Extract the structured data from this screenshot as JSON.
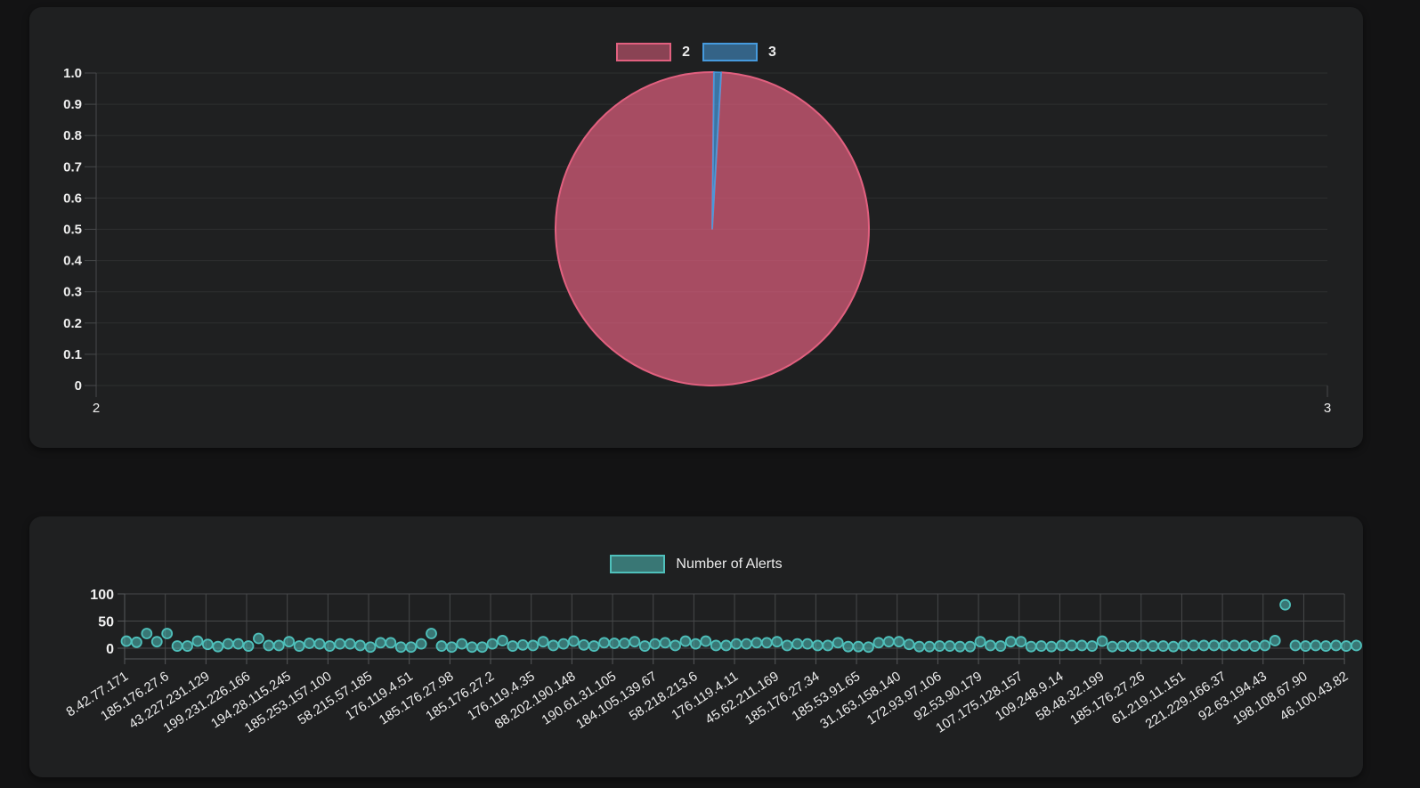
{
  "page": {
    "background": "#131314",
    "panel_background": "#1f2021"
  },
  "pie_panel": {
    "legend_labels": [
      "2",
      "3"
    ]
  },
  "scatter_panel": {
    "legend_labels": [
      "Number of Alerts"
    ]
  },
  "chart_data": [
    {
      "type": "pie",
      "title": "",
      "legend": [
        "2",
        "3"
      ],
      "legend_position": "top-center",
      "slices": [
        {
          "name": "2",
          "fraction": 0.9925,
          "color": "#e1607f"
        },
        {
          "name": "3",
          "fraction": 0.0075,
          "color": "#469add"
        }
      ],
      "slice_start_offset_deg": 0.6,
      "y_axis": {
        "tick_labels": [
          "1.0",
          "0.9",
          "0.8",
          "0.7",
          "0.6",
          "0.5",
          "0.4",
          "0.3",
          "0.2",
          "0.1",
          "0"
        ],
        "range": [
          0,
          1
        ]
      },
      "x_axis": {
        "tick_labels": [
          "2",
          "3"
        ],
        "range": [
          2,
          3
        ]
      },
      "grid": "horizontal-only"
    },
    {
      "type": "scatter",
      "series_name": "Number of Alerts",
      "color": "#4fc0bb",
      "legend_position": "top-center",
      "y_axis": {
        "tick_labels": [
          "100",
          "50",
          "0"
        ],
        "tick_values": [
          100,
          50,
          0
        ],
        "range": [
          0,
          100
        ]
      },
      "x_tick_labels": [
        "8.42.77.171",
        "185.176.27.6",
        "43.227.231.129",
        "199.231.226.166",
        "194.28.115.245",
        "185.253.157.100",
        "58.215.57.185",
        "176.119.4.51",
        "185.176.27.98",
        "185.176.27.2",
        "176.119.4.35",
        "88.202.190.148",
        "190.61.31.105",
        "184.105.139.67",
        "58.218.213.6",
        "176.119.4.11",
        "45.62.211.169",
        "185.176.27.34",
        "185.53.91.65",
        "31.163.158.140",
        "172.93.97.106",
        "92.53.90.179",
        "107.175.128.157",
        "109.248.9.14",
        "58.48.32.199",
        "185.176.27.26",
        "61.219.11.151",
        "221.229.166.37",
        "92.63.194.43",
        "198.108.67.90",
        "46.100.43.82"
      ],
      "points_per_labeled_tick": 4,
      "values": [
        13,
        11,
        27,
        12,
        27,
        4,
        4,
        13,
        7,
        3,
        8,
        8,
        4,
        18,
        5,
        5,
        12,
        4,
        9,
        8,
        4,
        8,
        8,
        5,
        2,
        10,
        10,
        2,
        2,
        8,
        27,
        4,
        2,
        8,
        2,
        2,
        8,
        14,
        4,
        6,
        5,
        12,
        5,
        8,
        13,
        6,
        4,
        10,
        9,
        9,
        12,
        4,
        8,
        10,
        5,
        13,
        8,
        13,
        5,
        5,
        8,
        8,
        10,
        10,
        12,
        5,
        8,
        8,
        5,
        5,
        10,
        3,
        3,
        2,
        10,
        12,
        12,
        7,
        3,
        3,
        4,
        4,
        3,
        3,
        12,
        5,
        4,
        12,
        12,
        3,
        4,
        3,
        5,
        5,
        5,
        4,
        13,
        3,
        4,
        4,
        5,
        4,
        4,
        3,
        5,
        5,
        5,
        5,
        5,
        5,
        5,
        4,
        5,
        14,
        80,
        5,
        4,
        5,
        4,
        5,
        4,
        5
      ]
    }
  ]
}
